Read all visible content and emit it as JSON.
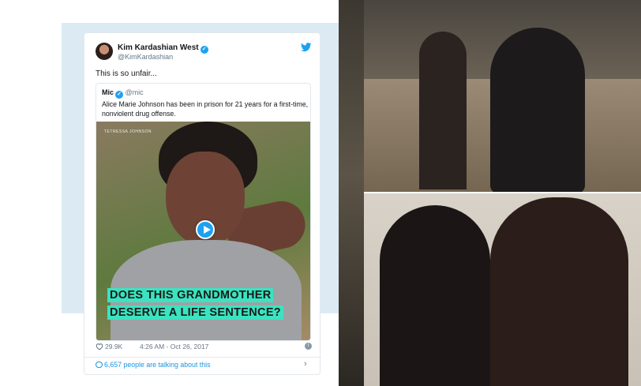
{
  "tweet": {
    "author_name": "Kim Kardashian West",
    "author_handle": "@KimKardashian",
    "text": "This is so unfair...",
    "quoted": {
      "author_name": "Mic",
      "author_handle": "@mic",
      "text": "Alice Marie Johnson has been in prison for 21 years for a first-time, nonviolent drug offense.",
      "media_credit": "TETRESSA JOHNSON",
      "caption_line1": "DOES THIS GRANDMOTHER",
      "caption_line2": "DESERVE A LIFE SENTENCE?"
    },
    "likes": "29.9K",
    "timestamp": "4:26 AM - Oct 26, 2017",
    "talking": "6,657 people are talking about this"
  },
  "colors": {
    "accent_blue": "#1da1f2",
    "caption_highlight": "#3be3c0",
    "panel_bg": "#dcebf3"
  },
  "icons": [
    "verified-icon",
    "twitter-bird-icon",
    "play-icon",
    "heart-icon",
    "info-icon",
    "comment-icon",
    "chevron-right-icon"
  ]
}
